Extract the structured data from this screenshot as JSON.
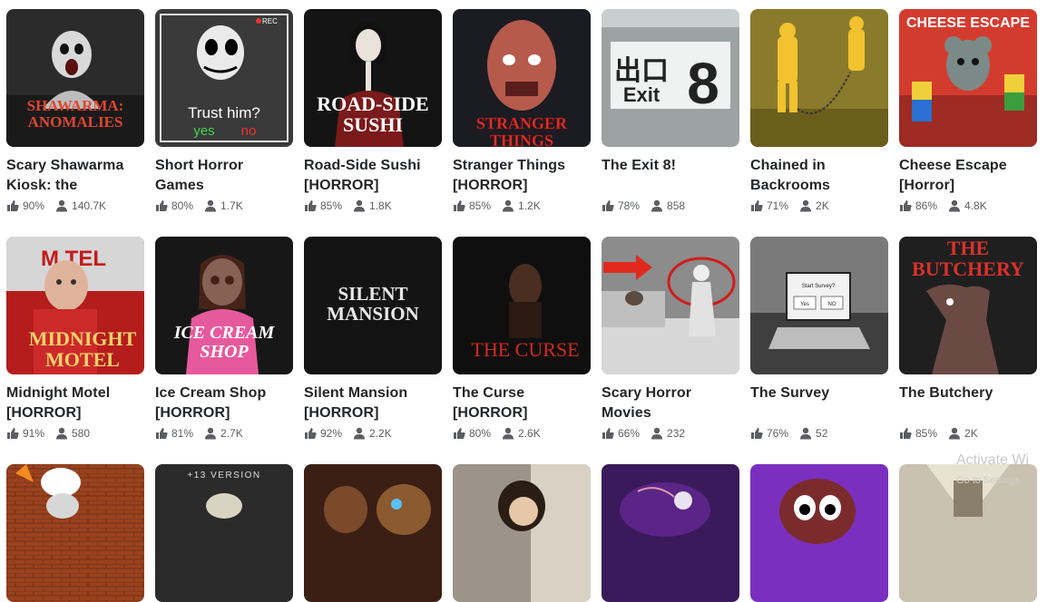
{
  "rows": [
    [
      {
        "title": "Scary Shawarma Kiosk: the",
        "rating": "90%",
        "players": "140.7K",
        "art": "shawarma",
        "caption": "SHAWARMA:\nANOMALIES"
      },
      {
        "title": "Short Horror Games",
        "rating": "80%",
        "players": "1.7K",
        "art": "trust",
        "caption": "Trust him?"
      },
      {
        "title": "Road-Side Sushi [HORROR]",
        "rating": "85%",
        "players": "1.8K",
        "art": "sushi",
        "caption": "ROAD-SIDE\nSUSHI"
      },
      {
        "title": "Stranger Things [HORROR]",
        "rating": "85%",
        "players": "1.2K",
        "art": "stranger",
        "caption": "STRANGER\nTHINGS"
      },
      {
        "title": "The Exit 8!",
        "rating": "78%",
        "players": "858",
        "art": "exit8",
        "caption": "Exit"
      },
      {
        "title": "Chained in Backrooms",
        "rating": "71%",
        "players": "2K",
        "art": "chained",
        "caption": ""
      },
      {
        "title": "Cheese Escape [Horror]",
        "rating": "86%",
        "players": "4.8K",
        "art": "cheese",
        "caption": "CHEESE ESCAPE"
      }
    ],
    [
      {
        "title": "Midnight Motel [HORROR]",
        "rating": "91%",
        "players": "580",
        "art": "motel",
        "caption": "MIDNIGHT\nMOTEL"
      },
      {
        "title": "Ice Cream Shop [HORROR]",
        "rating": "81%",
        "players": "2.7K",
        "art": "icecream",
        "caption": "ICE CREAM\nSHOP"
      },
      {
        "title": "Silent Mansion [HORROR]",
        "rating": "92%",
        "players": "2.2K",
        "art": "mansion",
        "caption": "SILENT\nMANSION"
      },
      {
        "title": "The Curse [HORROR]",
        "rating": "80%",
        "players": "2.6K",
        "art": "curse",
        "caption": "THE CURSE"
      },
      {
        "title": "Scary Horror Movies",
        "rating": "66%",
        "players": "232",
        "art": "movies",
        "caption": ""
      },
      {
        "title": "The Survey",
        "rating": "76%",
        "players": "52",
        "art": "survey",
        "caption": "Start Survey?"
      },
      {
        "title": "The Butchery",
        "rating": "85%",
        "players": "2K",
        "art": "butchery",
        "caption": "THE\nBUTCHERY"
      }
    ],
    [
      {
        "title": "",
        "rating": "",
        "players": "",
        "art": "chef",
        "caption": ""
      },
      {
        "title": "",
        "rating": "",
        "players": "",
        "art": "version",
        "caption": "+13 VERSION"
      },
      {
        "title": "",
        "rating": "",
        "players": "",
        "art": "fnaf",
        "caption": ""
      },
      {
        "title": "",
        "rating": "",
        "players": "",
        "art": "hall",
        "caption": ""
      },
      {
        "title": "",
        "rating": "",
        "players": "",
        "art": "purple",
        "caption": ""
      },
      {
        "title": "",
        "rating": "",
        "players": "",
        "art": "cartoon",
        "caption": ""
      },
      {
        "title": "",
        "rating": "",
        "players": "",
        "art": "corridor",
        "caption": ""
      }
    ]
  ],
  "watermark": {
    "line1": "Activate Wi",
    "line2": "Go to Settings"
  },
  "colors": {
    "title": "#232527",
    "stat": "#5c5e61"
  }
}
